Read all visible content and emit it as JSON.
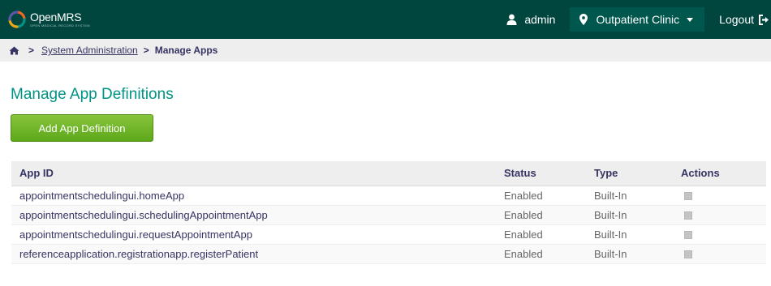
{
  "header": {
    "logo_text": "OpenMRS",
    "logo_tagline": "OPEN MEDICAL RECORD SYSTEM",
    "user_label": "admin",
    "location_label": "Outpatient Clinic",
    "logout_label": "Logout",
    "icons": {
      "user": "user-icon",
      "location": "map-pin-icon",
      "dropdown": "caret-down-icon",
      "logout": "logout-icon"
    }
  },
  "breadcrumb": {
    "home_icon": "home-icon",
    "parent_label": "System Administration",
    "current_label": "Manage Apps"
  },
  "page": {
    "title": "Manage App Definitions",
    "add_button_label": "Add App Definition"
  },
  "table": {
    "headers": [
      "App ID",
      "Status",
      "Type",
      "Actions"
    ],
    "rows": [
      {
        "app_id": "appointmentschedulingui.homeApp",
        "status": "Enabled",
        "type": "Built-In"
      },
      {
        "app_id": "appointmentschedulingui.schedulingAppointmentApp",
        "status": "Enabled",
        "type": "Built-In"
      },
      {
        "app_id": "appointmentschedulingui.requestAppointmentApp",
        "status": "Enabled",
        "type": "Built-In"
      },
      {
        "app_id": "referenceapplication.registrationapp.registerPatient",
        "status": "Enabled",
        "type": "Built-In"
      }
    ],
    "action_icon": "disabled-action-icon"
  },
  "colors": {
    "header_bg": "#00463f",
    "title": "#009384",
    "button": "#6db22b",
    "text": "#363463"
  }
}
